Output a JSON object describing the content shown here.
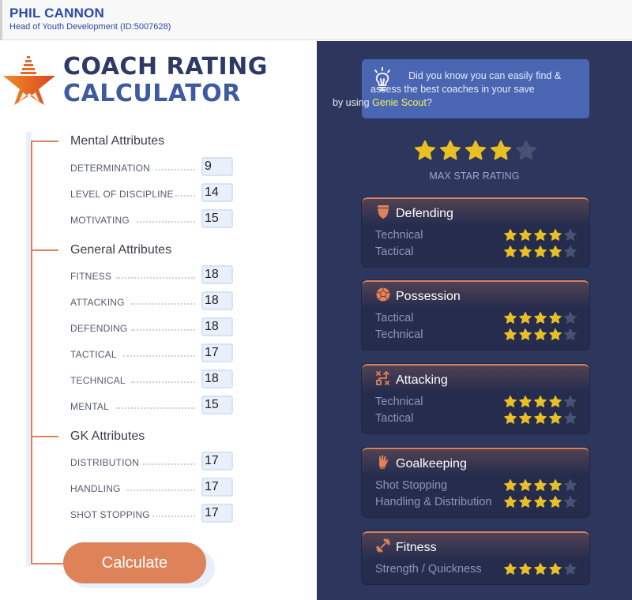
{
  "header": {
    "name": "PHIL CANNON",
    "role": "Head of Youth Development (ID:5007628)"
  },
  "title": {
    "line1": "COACH RATING",
    "line2": "CALCULATOR"
  },
  "groups": [
    {
      "title": "Mental Attributes",
      "attributes": [
        {
          "label": "DETERMINATION",
          "value": "9"
        },
        {
          "label": "LEVEL OF DISCIPLINE",
          "value": "14"
        },
        {
          "label": "MOTIVATING",
          "value": "15"
        }
      ]
    },
    {
      "title": "General Attributes",
      "attributes": [
        {
          "label": "FITNESS",
          "value": "18"
        },
        {
          "label": "ATTACKING",
          "value": "18"
        },
        {
          "label": "DEFENDING",
          "value": "18"
        },
        {
          "label": "TACTICAL",
          "value": "17"
        },
        {
          "label": "TECHNICAL",
          "value": "18"
        },
        {
          "label": "MENTAL",
          "value": "15"
        }
      ]
    },
    {
      "title": "GK Attributes",
      "attributes": [
        {
          "label": "DISTRIBUTION",
          "value": "17"
        },
        {
          "label": "HANDLING",
          "value": "17"
        },
        {
          "label": "SHOT STOPPING",
          "value": "17"
        }
      ]
    }
  ],
  "calculate_label": "Calculate",
  "tip": {
    "icon": "lightbulb-icon",
    "line1": "Did you know you can easily find &",
    "line2": "assess the best coaches in your save",
    "line3_prefix": "by using ",
    "link": "Genie Scout",
    "line3_suffix": "?"
  },
  "max_rating": {
    "stars": 4,
    "out_of": 5,
    "label": "MAX STAR RATING"
  },
  "cards": [
    {
      "title": "Defending",
      "icon": "shield-icon",
      "rows": [
        {
          "label": "Technical",
          "stars": 4
        },
        {
          "label": "Tactical",
          "stars": 4
        }
      ]
    },
    {
      "title": "Possession",
      "icon": "ball-icon",
      "rows": [
        {
          "label": "Tactical",
          "stars": 4
        },
        {
          "label": "Technical",
          "stars": 4
        }
      ]
    },
    {
      "title": "Attacking",
      "icon": "tactics-board-icon",
      "rows": [
        {
          "label": "Technical",
          "stars": 4
        },
        {
          "label": "Tactical",
          "stars": 4
        }
      ]
    },
    {
      "title": "Goalkeeping",
      "icon": "goalkeeper-glove-icon",
      "rows": [
        {
          "label": "Shot Stopping",
          "stars": 4
        },
        {
          "label": "Handling & Distribution",
          "stars": 4
        }
      ]
    },
    {
      "title": "Fitness",
      "icon": "dumbbell-icon",
      "rows": [
        {
          "label": "Strength / Quickness",
          "stars": 4
        }
      ]
    }
  ],
  "colors": {
    "accent": "#dd8259",
    "star_on": "#e8c024",
    "star_off": "#4a5274",
    "panel": "#2d365c",
    "title_dark": "#2d3a66",
    "title_blue": "#3d5aa2"
  }
}
